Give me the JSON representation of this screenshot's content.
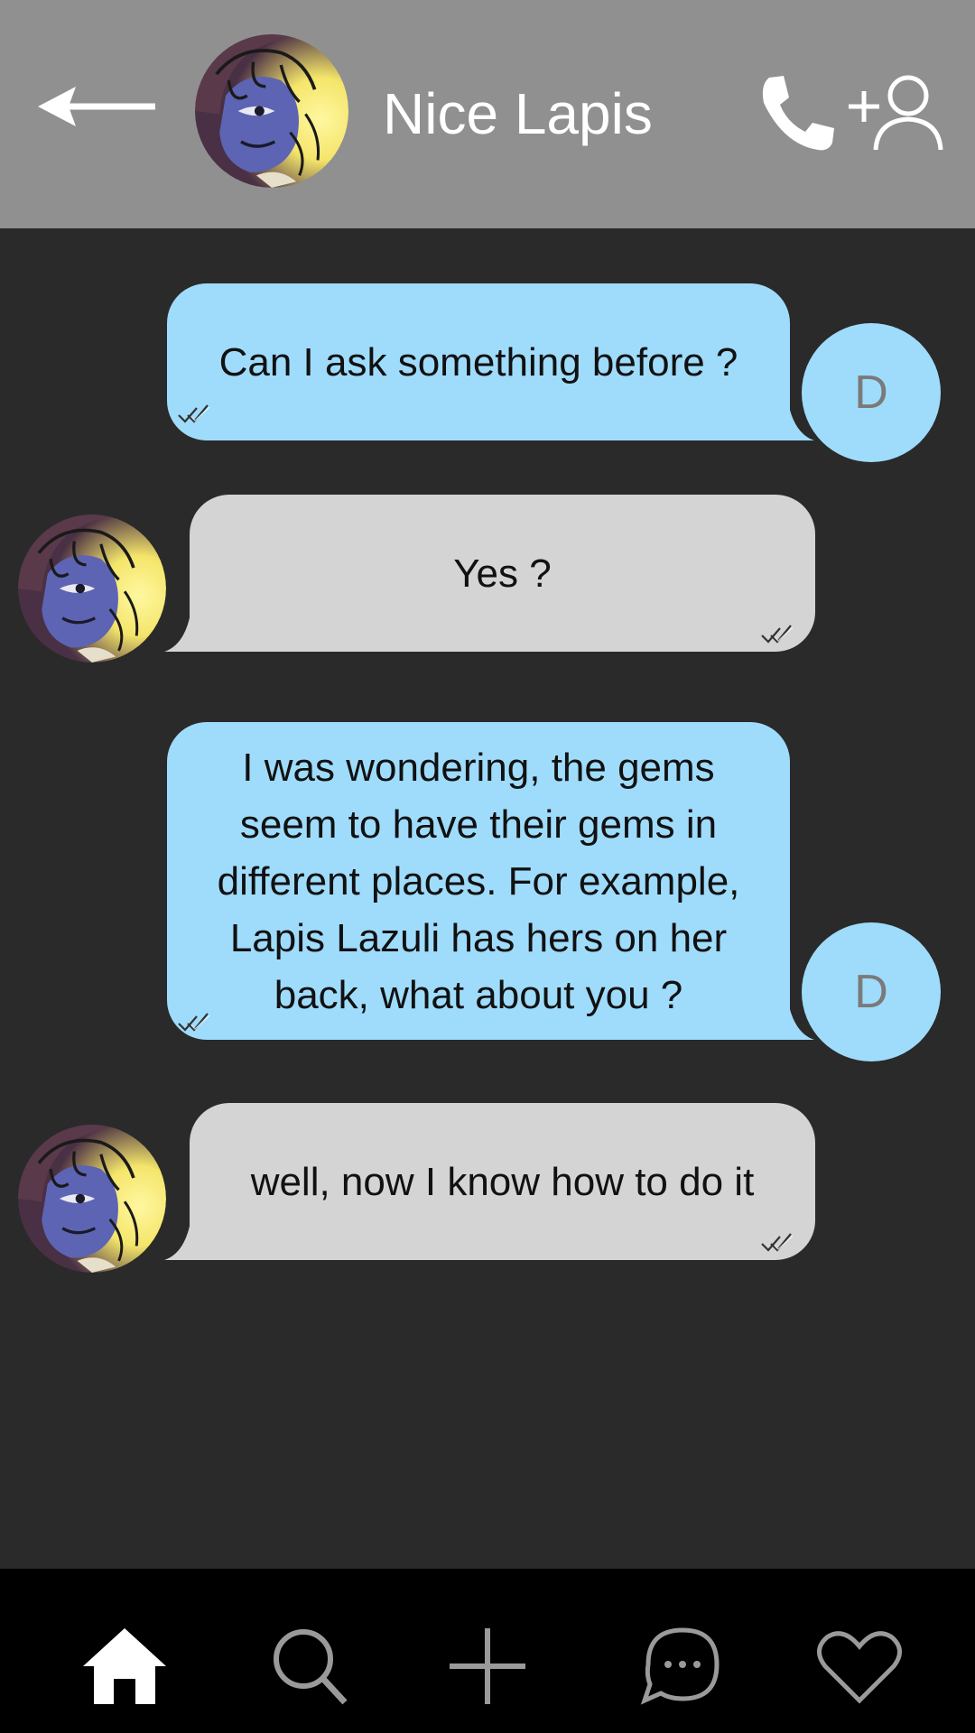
{
  "header": {
    "contact_name": "Nice Lapis",
    "icons": {
      "back": "arrow-left-icon",
      "avatar": "lapis-avatar",
      "call": "phone-icon",
      "add_contact": "add-user-icon"
    }
  },
  "messages": [
    {
      "direction": "sent",
      "text": "Can I ask something before ?",
      "avatar_initial": "D",
      "status": "read"
    },
    {
      "direction": "received",
      "text": "Yes ?",
      "status": "read"
    },
    {
      "direction": "sent",
      "text": "I was wondering, the gems seem to have their gems in different places. For example, Lapis Lazuli has hers on her back, what about you ?",
      "avatar_initial": "D",
      "status": "read"
    },
    {
      "direction": "received",
      "text": "well, now I know how to do it",
      "status": "read"
    }
  ],
  "bottom_nav": {
    "items": [
      {
        "icon": "home-icon",
        "active": true
      },
      {
        "icon": "search-icon",
        "active": false
      },
      {
        "icon": "plus-icon",
        "active": false
      },
      {
        "icon": "chat-bubble-icon",
        "active": false
      },
      {
        "icon": "heart-icon",
        "active": false
      }
    ]
  },
  "colors": {
    "header_bg": "#909090",
    "chat_bg": "#2a2a2a",
    "sent_bubble": "#9fdcfc",
    "received_bubble": "#d4d4d4",
    "nav_bg": "#000000",
    "nav_active": "#ffffff",
    "nav_inactive": "#9a9a9a"
  }
}
